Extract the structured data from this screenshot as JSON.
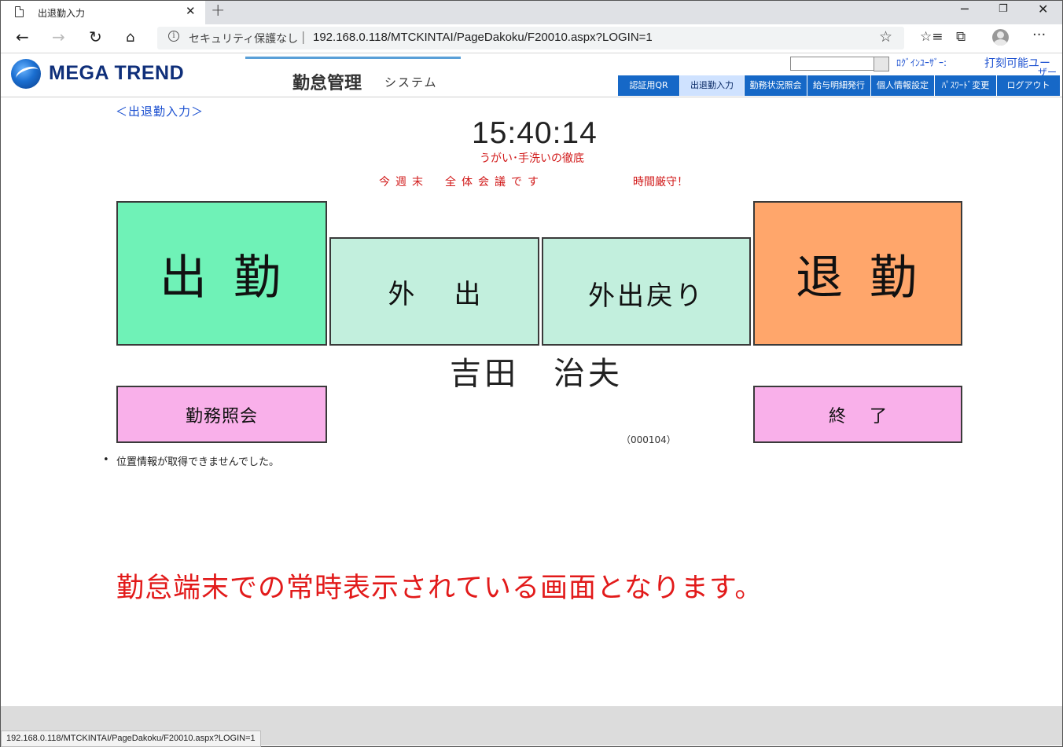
{
  "browser": {
    "tab_title": "出退勤入力",
    "tab_close": "✕",
    "new_tab": "+",
    "security_label": "セキュリティ保護なし",
    "url": "192.168.0.118/MTCKINTAI/PageDakoku/F20010.aspx?LOGIN=1",
    "status_url": "192.168.0.118/MTCKINTAI/PageDakoku/F20010.aspx?LOGIN=1"
  },
  "header": {
    "logo_text": "MEGA TREND",
    "system_title": "勤怠管理",
    "system_subtitle": "システム",
    "login_label": "ﾛｸﾞｲﾝﾕｰｻﾞｰ:",
    "login_user": "打刻可能ユー",
    "login_user_wrap": "ザー"
  },
  "menu": [
    {
      "label": "認証用QR",
      "active": false
    },
    {
      "label": "出退勤入力",
      "active": true
    },
    {
      "label": "勤務状況照会",
      "active": false
    },
    {
      "label": "給与明細発行",
      "active": false
    },
    {
      "label": "個人情報設定",
      "active": false
    },
    {
      "label": "ﾊﾟｽﾜｰﾄﾞ変更",
      "active": false
    },
    {
      "label": "ログアウト",
      "active": false
    }
  ],
  "main": {
    "page_title": "＜出退勤入力＞",
    "clock": "15:40:14",
    "message_1": "うがい･手洗いの徹底",
    "message_2": "今週末　全体会議です",
    "message_3": "時間厳守！",
    "clock_in": "出勤",
    "go_out": "外出",
    "return": "外出戻り",
    "clock_out": "退勤",
    "employee_name": "吉田　治夫",
    "work_inquiry": "勤務照会",
    "end": "終了",
    "employee_code": "（000104）",
    "location_error": "位置情報が取得できませんでした。",
    "caption": "勤怠端末での常時表示されている画面となります。"
  },
  "colors": {
    "clock_in": "#6ff2b7",
    "go_out": "#c2efdd",
    "clock_out": "#ffa66b",
    "sub_buttons": "#f9b0ea",
    "menu": "#1668c7",
    "notice": "#d11a1a"
  }
}
